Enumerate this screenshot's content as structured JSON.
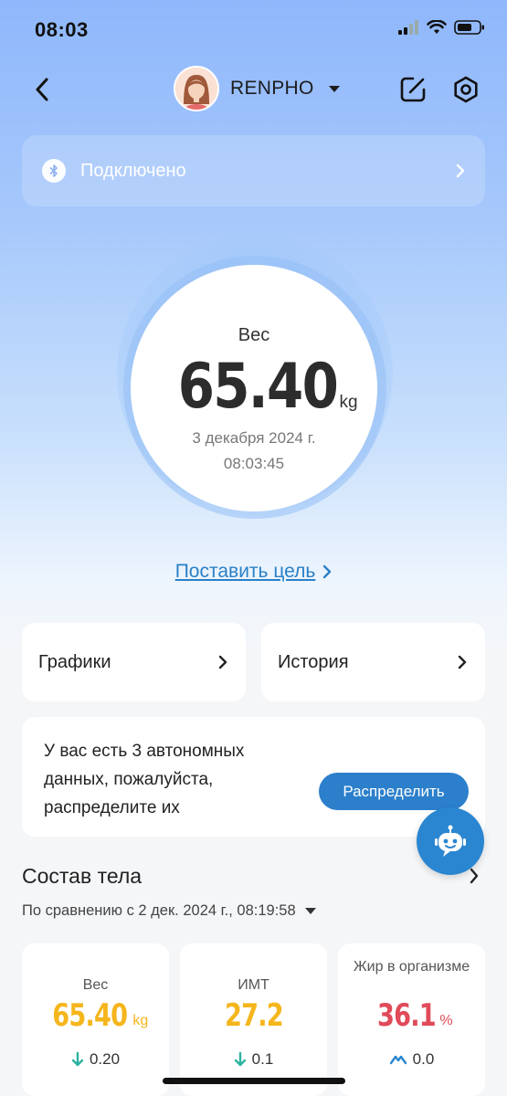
{
  "status_bar": {
    "time": "08:03"
  },
  "header": {
    "profile_name": "RENPHO"
  },
  "connection": {
    "label": "Подключено"
  },
  "weight": {
    "label": "Вес",
    "value": "65.40",
    "unit": "kg",
    "date": "3 декабря 2024 г.",
    "time": "08:03:45"
  },
  "goal": {
    "label": "Поставить цель"
  },
  "nav_cards": [
    {
      "label": "Графики"
    },
    {
      "label": "История"
    }
  ],
  "offline": {
    "message": "У вас есть 3 автономных данных, пожалуйста, распределите их",
    "button_label": "Распределить"
  },
  "body_composition": {
    "title": "Состав тела",
    "comparison": "По сравнению с 2 дек. 2024 г., 08:19:58"
  },
  "metrics": [
    {
      "name": "Вес",
      "value": "65.40",
      "unit": "kg",
      "delta": "0.20",
      "color": "#f5b51c"
    },
    {
      "name": "ИМТ",
      "value": "27.2",
      "unit": "",
      "delta": "0.1",
      "color": "#f5b51c"
    },
    {
      "name": "Жир в организме",
      "value": "36.1",
      "unit": "%",
      "delta": "0.0",
      "color": "#e04a59"
    }
  ],
  "colors": {
    "accent": "#2b7fcb",
    "delta_down": "#2bb3a0",
    "warning": "#f5b51c",
    "danger": "#e04a59"
  }
}
